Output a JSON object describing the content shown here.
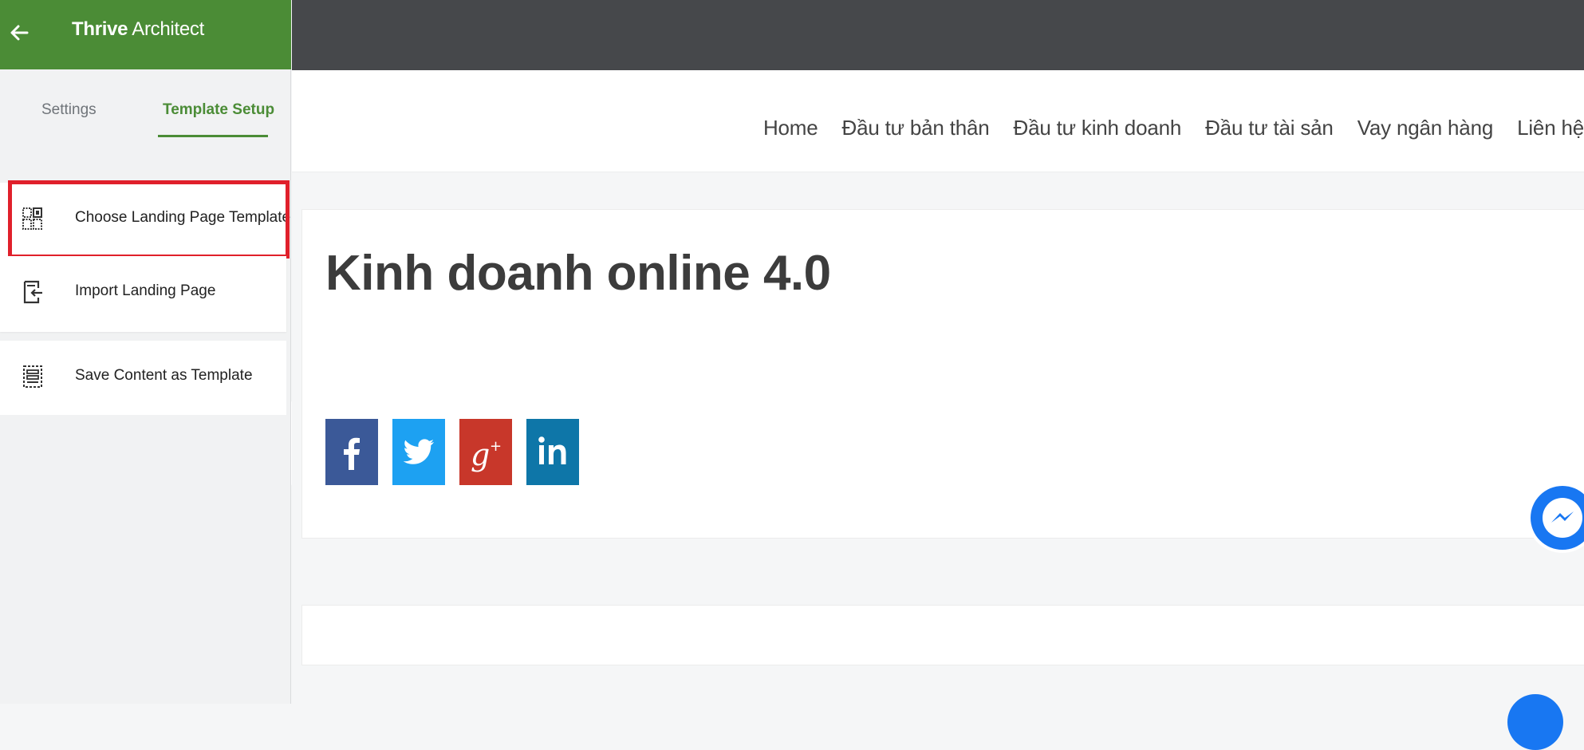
{
  "panel": {
    "app_title_bold": "Thrive",
    "app_title_rest": " Architect",
    "tabs": [
      {
        "label": "Settings",
        "active": false
      },
      {
        "label": "Template Setup",
        "active": true
      }
    ],
    "menu": [
      {
        "label": "Choose Landing Page Template",
        "icon": "template-grid-icon",
        "highlighted": true
      },
      {
        "label": "Import Landing Page",
        "icon": "import-icon"
      },
      {
        "label": "Save Content as Template",
        "icon": "save-template-icon"
      }
    ],
    "accent_color": "#4b8c36",
    "highlight_color": "#e0202b"
  },
  "site": {
    "nav": [
      "Home",
      "Đầu tư bản thân",
      "Đầu tư kinh doanh",
      "Đầu tư tài sản",
      "Vay ngân hàng",
      "Liên hệ"
    ],
    "post_title": "Kinh doanh online 4.0",
    "share_buttons": [
      {
        "network": "facebook",
        "icon": "facebook-icon",
        "color": "#3b5998"
      },
      {
        "network": "twitter",
        "icon": "twitter-icon",
        "color": "#1da1f2"
      },
      {
        "network": "google-plus",
        "icon": "google-plus-icon",
        "color": "#c8372a"
      },
      {
        "network": "linkedin",
        "icon": "linkedin-icon",
        "color": "#0e76a8"
      }
    ]
  }
}
